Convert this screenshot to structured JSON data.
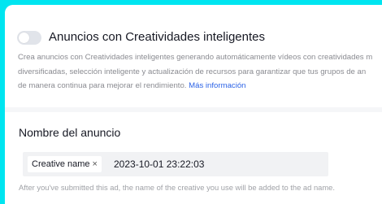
{
  "smart_creative": {
    "toggle_on": false,
    "title": "Anuncios con Creatividades inteligentes",
    "description_lines": [
      "Crea anuncios con Creatividades inteligentes generando automáticamente vídeos con creatividades m",
      "diversificadas, selección inteligente y actualización de recursos para garantizar que tus grupos de an",
      "de manera continua para mejorar el rendimiento."
    ],
    "more_info_link": "Más información"
  },
  "ad_name": {
    "section_title": "Nombre del anuncio",
    "chip_label": "Creative name",
    "chip_close": "×",
    "date_value": "2023-10-01 23:22:03",
    "hint": "After you've submitted this ad, the name of the creative you use will be added to the ad name."
  },
  "colors": {
    "accent_border": "#00e5f0",
    "link": "#2c63e6"
  }
}
